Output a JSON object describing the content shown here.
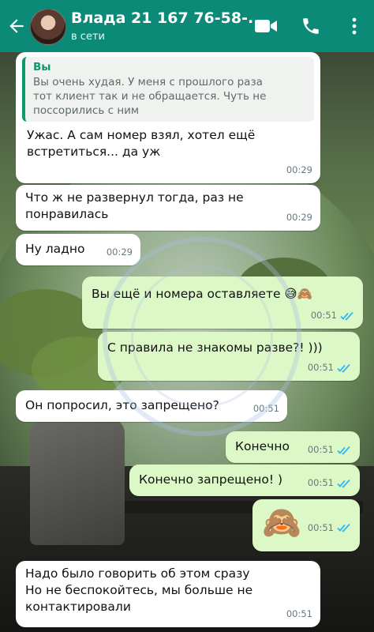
{
  "header": {
    "contact_name": "Влада 21 167 76-58-...",
    "status": "в сети",
    "colors": {
      "bar": "#0b8a78"
    },
    "icons": [
      "back-arrow-icon",
      "video-call-icon",
      "phone-icon",
      "more-vert-icon"
    ]
  },
  "messages": [
    {
      "direction": "in",
      "quote": {
        "author": "Вы",
        "text": "Вы очень худая. У меня с прошлого раза\nтот клиент так и не обращается. Чуть не\nпоссорились с ним"
      },
      "text": "Ужас. А сам номер взял, хотел ещё\nвстретиться... да уж",
      "time": "00:29"
    },
    {
      "direction": "in",
      "text": "Что ж не развернул тогда, раз не\nпонравилась",
      "time": "00:29"
    },
    {
      "direction": "in",
      "text": "Ну ладно",
      "time": "00:29"
    },
    {
      "direction": "out",
      "text": "Вы ещё и номера оставляете 😅🙈",
      "time": "00:51",
      "status": "read"
    },
    {
      "direction": "out",
      "text": "С правила не знакомы разве?! )))",
      "time": "00:51",
      "status": "read"
    },
    {
      "direction": "in",
      "text": "Он попросил, это запрещено?",
      "time": "00:51"
    },
    {
      "direction": "out",
      "text": "Конечно",
      "time": "00:51",
      "status": "read"
    },
    {
      "direction": "out",
      "text": "Конечно запрещено! )",
      "time": "00:51",
      "status": "read"
    },
    {
      "direction": "out",
      "text": "🙈",
      "time": "00:51",
      "status": "read"
    },
    {
      "direction": "in",
      "text": "Надо было говорить об этом сразу\nНо не беспокойтесь, мы больше не\nконтактировали",
      "time": "00:51"
    }
  ],
  "colors": {
    "incoming": "#ffffff",
    "outgoing": "#dcf8c6",
    "read_ticks": "#34b7f1",
    "quote_accent": "#0b9a6a"
  }
}
